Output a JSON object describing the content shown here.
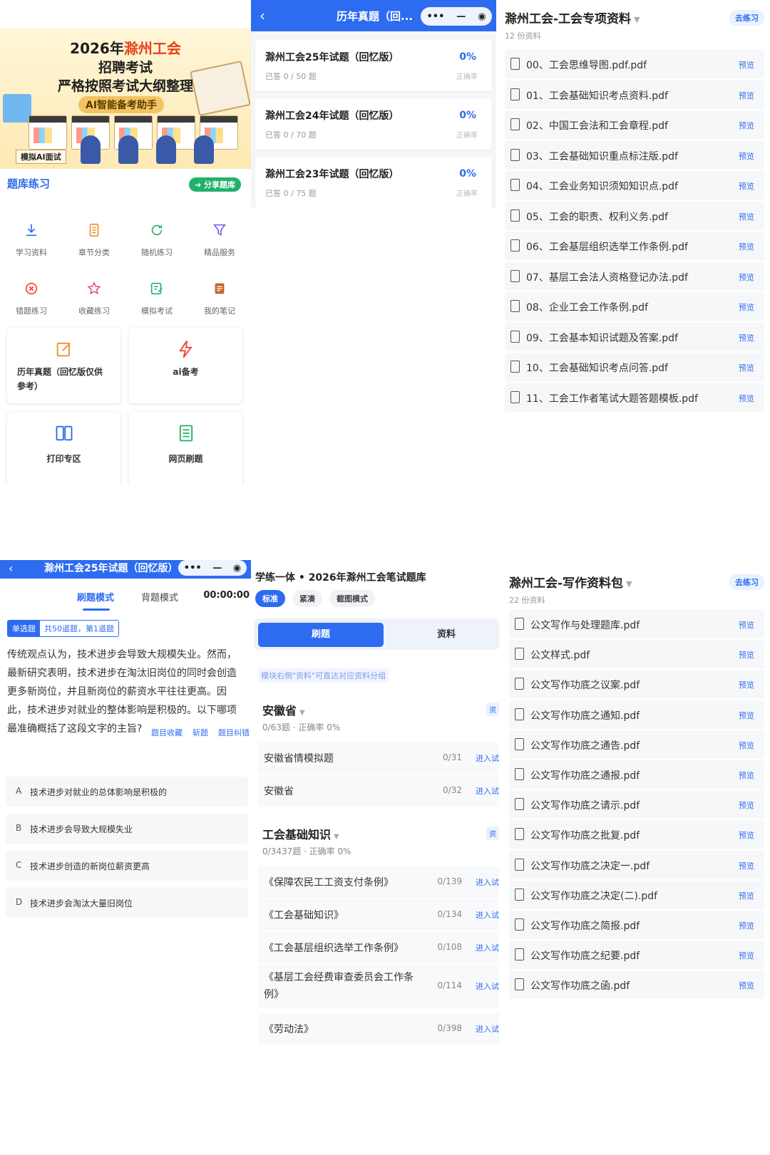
{
  "home": {
    "banner": {
      "line1_prefix": "2026年",
      "line1_highlight": "滁州工会",
      "line2": "招聘考试",
      "line3": "严格按照考试大纲整理",
      "pill": "AI智能备考助手",
      "badge": "模拟AI面试"
    },
    "section_title": "题库练习",
    "share_label": "分享题库",
    "grid_row1": [
      {
        "label": "学习资料",
        "icon": "download-icon"
      },
      {
        "label": "章节分类",
        "icon": "chapter-icon"
      },
      {
        "label": "随机练习",
        "icon": "refresh-icon"
      },
      {
        "label": "精品服务",
        "icon": "filter-icon"
      }
    ],
    "grid_row2": [
      {
        "label": "错题练习",
        "icon": "wrong-icon"
      },
      {
        "label": "收藏练习",
        "icon": "star-icon"
      },
      {
        "label": "模拟考试",
        "icon": "exam-icon"
      },
      {
        "label": "我的笔记",
        "icon": "note-icon"
      }
    ],
    "cards": [
      {
        "label": "历年真题（回忆版仅供参考）",
        "icon": "edit-icon"
      },
      {
        "label": "ai备考",
        "icon": "ai-icon"
      },
      {
        "label": "打印专区",
        "icon": "print-icon"
      },
      {
        "label": "网页刷题",
        "icon": "webpage-icon"
      }
    ]
  },
  "exams": {
    "nav_title": "历年真题（回...",
    "capsule": {
      "more": "•••",
      "min": "—",
      "close": "◉"
    },
    "items": [
      {
        "name": "滁州工会25年试题（回忆版）",
        "progress": "已答 0 / 50 题",
        "pct": "0%",
        "rate": "正确率"
      },
      {
        "name": "滁州工会24年试题（回忆版）",
        "progress": "已答 0 / 70 题",
        "pct": "0%",
        "rate": "正确率"
      },
      {
        "name": "滁州工会23年试题（回忆版）",
        "progress": "已答 0 / 75 题",
        "pct": "0%",
        "rate": "正确率"
      }
    ]
  },
  "special": {
    "title": "滁州工会-工会专项资料",
    "count": "12 份资料",
    "go_label": "去练习",
    "preview_label": "预览",
    "files": [
      "00、工会思维导图.pdf.pdf",
      "01、工会基础知识考点资料.pdf",
      "02、中国工会法和工会章程.pdf",
      "03、工会基础知识重点标注版.pdf",
      "04、工会业务知识须知知识点.pdf",
      "05、工会的职责、权利义务.pdf",
      "06、工会基层组织选举工作条例.pdf",
      "07、基层工会法人资格登记办法.pdf",
      "08、企业工会工作条例.pdf",
      "09、工会基本知识试题及答案.pdf",
      "10、工会基础知识考点问答.pdf",
      "11、工会工作者笔试大题答题模板.pdf"
    ]
  },
  "question": {
    "nav_title": "滁州工会25年试题（回忆版）",
    "mode_active": "刷题模式",
    "mode_other": "背题模式",
    "timer": "00:00:00",
    "type_tag": "单选题",
    "progress_tag": "共50道题，第1道题",
    "text": "传统观点认为，技术进步会导致大规模失业。然而，最新研究表明，技术进步在淘汰旧岗位的同时会创造更多新岗位，并且新岗位的薪资水平往往更高。因此，技术进步对就业的整体影响是积极的。以下哪项最准确概括了这段文字的主旨?",
    "actions": [
      "题目收藏",
      "斩题",
      "题目纠错"
    ],
    "options": [
      {
        "key": "A",
        "text": "技术进步对就业的总体影响是积极的"
      },
      {
        "key": "B",
        "text": "技术进步会导致大规模失业"
      },
      {
        "key": "C",
        "text": "技术进步创造的新岗位薪资更高"
      },
      {
        "key": "D",
        "text": "技术进步会淘汰大量旧岗位"
      }
    ]
  },
  "bank": {
    "title": "学练一体 • 2026年滁州工会笔试题库",
    "chips": [
      "标准",
      "紧凑",
      "截图模式"
    ],
    "seg_active": "刷题",
    "seg_other": "资料",
    "hint": "模块右侧\"资料\"可直达对应资料分组",
    "groups": [
      {
        "name": "安徽省",
        "stats": "0/63题 · 正确率 0%",
        "tag": "资",
        "items": [
          {
            "name": "安徽省情模拟题",
            "count": "0/31",
            "enter": "进入试"
          },
          {
            "name": "安徽省",
            "count": "0/32",
            "enter": "进入试"
          }
        ]
      },
      {
        "name": "工会基础知识",
        "stats": "0/3437题 · 正确率 0%",
        "tag": "资",
        "items": [
          {
            "name": "《保障农民工工资支付条例》",
            "count": "0/139",
            "enter": "进入试"
          },
          {
            "name": "《工会基础知识》",
            "count": "0/134",
            "enter": "进入试"
          },
          {
            "name": "《工会基层组织选举工作条例》",
            "count": "0/108",
            "enter": "进入试"
          },
          {
            "name": "《基层工会经费审查委员会工作条例》",
            "count": "0/114",
            "enter": "进入试"
          },
          {
            "name": "《劳动法》",
            "count": "0/398",
            "enter": "进入试"
          }
        ]
      }
    ]
  },
  "writing": {
    "title": "滁州工会-写作资料包",
    "count": "22 份资料",
    "go_label": "去练习",
    "preview_label": "预览",
    "files": [
      "公文写作与处理题库.pdf",
      "公文样式.pdf",
      "公文写作功底之议案.pdf",
      "公文写作功底之通知.pdf",
      "公文写作功底之通告.pdf",
      "公文写作功底之通报.pdf",
      "公文写作功底之请示.pdf",
      "公文写作功底之批复.pdf",
      "公文写作功底之决定一.pdf",
      "公文写作功底之决定(二).pdf",
      "公文写作功底之简报.pdf",
      "公文写作功底之纪要.pdf",
      "公文写作功底之函.pdf"
    ]
  },
  "colors": {
    "primary": "#2d6cf0",
    "accent_red": "#e7421c",
    "share_green": "#21b06a"
  }
}
